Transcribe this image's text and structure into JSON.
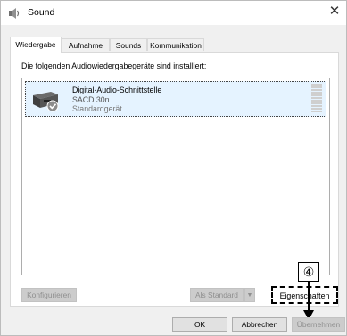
{
  "window": {
    "title": "Sound"
  },
  "tabs": [
    {
      "label": "Wiedergabe",
      "active": true
    },
    {
      "label": "Aufnahme",
      "active": false
    },
    {
      "label": "Sounds",
      "active": false
    },
    {
      "label": "Kommunikation",
      "active": false
    }
  ],
  "panel": {
    "heading": "Die folgenden Audiowiedergabegeräte sind installiert:",
    "devices": [
      {
        "name": "Digital-Audio-Schnittstelle",
        "model": "SACD 30n",
        "status": "Standardgerät",
        "icon": "digital-audio-device-icon",
        "is_default": true
      }
    ]
  },
  "buttons": {
    "configure": "Konfigurieren",
    "set_default": "Als Standard",
    "properties": "Eigenschaften",
    "ok": "OK",
    "cancel": "Abbrechen",
    "apply": "Übernehmen"
  },
  "callout": {
    "label": "④"
  },
  "icons": {
    "app": "speaker-icon",
    "close": "close-icon"
  }
}
